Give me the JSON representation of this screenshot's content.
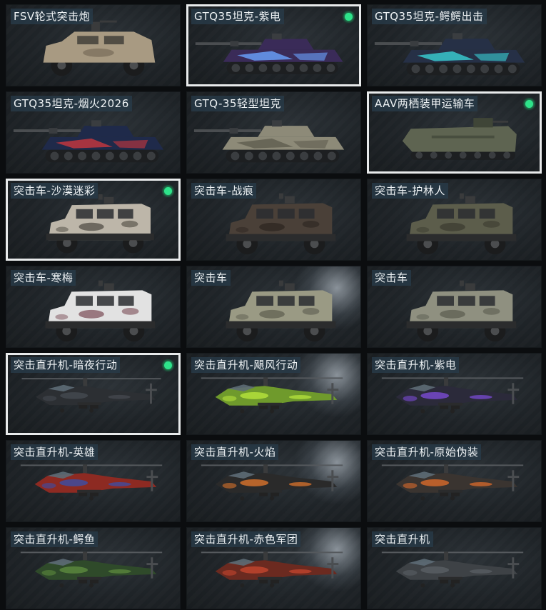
{
  "cards": [
    {
      "name": "FSV轮式突击炮",
      "selected": false,
      "equipped": false,
      "kind": "fsv",
      "color": "#a89a82",
      "accent": "#6f6452"
    },
    {
      "name": "GTQ35坦克-紫电",
      "selected": true,
      "equipped": true,
      "kind": "tank",
      "color": "#3a2b58",
      "accent": "#6aa4ff"
    },
    {
      "name": "GTQ35坦克-鳄鳄出击",
      "selected": false,
      "equipped": false,
      "kind": "tank",
      "color": "#263046",
      "accent": "#39d1d6"
    },
    {
      "name": "GTQ35坦克-烟火2026",
      "selected": false,
      "equipped": false,
      "kind": "tank",
      "color": "#1f2a4a",
      "accent": "#c9373d"
    },
    {
      "name": "GTQ-35轻型坦克",
      "selected": false,
      "equipped": false,
      "kind": "tank",
      "color": "#8d8a78",
      "accent": "#5f5c4f"
    },
    {
      "name": "AAV两栖装甲运输车",
      "selected": true,
      "equipped": true,
      "kind": "aav",
      "color": "#5e6451",
      "accent": "#3f4537"
    },
    {
      "name": "突击车-沙漠迷彩",
      "selected": true,
      "equipped": true,
      "kind": "truck",
      "color": "#bdb6a9",
      "accent": "#4b4740"
    },
    {
      "name": "突击车-战痕",
      "selected": false,
      "equipped": false,
      "kind": "truck",
      "color": "#4a4038",
      "accent": "#2b2420"
    },
    {
      "name": "突击车-护林人",
      "selected": false,
      "equipped": false,
      "kind": "truck",
      "color": "#5c5d4b",
      "accent": "#3a3b2f"
    },
    {
      "name": "突击车-寒梅",
      "selected": false,
      "equipped": false,
      "kind": "truck",
      "color": "#e2e2e2",
      "accent": "#7a4b55"
    },
    {
      "name": "突击车",
      "selected": false,
      "equipped": false,
      "kind": "truck",
      "color": "#9a9a84",
      "accent": "#5c5c4e"
    },
    {
      "name": "突击车",
      "selected": false,
      "equipped": false,
      "kind": "truck",
      "color": "#8f9080",
      "accent": "#5a5b4f"
    },
    {
      "name": "突击直升机-暗夜行动",
      "selected": true,
      "equipped": true,
      "kind": "heli",
      "color": "#2c2f33",
      "accent": "#454a50"
    },
    {
      "name": "突击直升机-飓风行动",
      "selected": false,
      "equipped": false,
      "kind": "heli",
      "color": "#6f9a2c",
      "accent": "#b6e33c"
    },
    {
      "name": "突击直升机-紫电",
      "selected": false,
      "equipped": false,
      "kind": "heli",
      "color": "#2b2a3a",
      "accent": "#7a4bd3"
    },
    {
      "name": "突击直升机-英雄",
      "selected": false,
      "equipped": false,
      "kind": "heli",
      "color": "#8d2a22",
      "accent": "#3b4fa8"
    },
    {
      "name": "突击直升机-火焰",
      "selected": false,
      "equipped": false,
      "kind": "heli",
      "color": "#2a2a2a",
      "accent": "#d9732c"
    },
    {
      "name": "突击直升机-原始伪装",
      "selected": false,
      "equipped": false,
      "kind": "heli",
      "color": "#3a3430",
      "accent": "#d96a2b"
    },
    {
      "name": "突击直升机-鳄鱼",
      "selected": false,
      "equipped": false,
      "kind": "heli",
      "color": "#2f4a2a",
      "accent": "#5d8a3e"
    },
    {
      "name": "突击直升机-赤色军团",
      "selected": false,
      "equipped": false,
      "kind": "heli",
      "color": "#6b2a20",
      "accent": "#c4462e"
    },
    {
      "name": "突击直升机",
      "selected": false,
      "equipped": false,
      "kind": "heli",
      "color": "#3e4246",
      "accent": "#5a5f64"
    }
  ]
}
